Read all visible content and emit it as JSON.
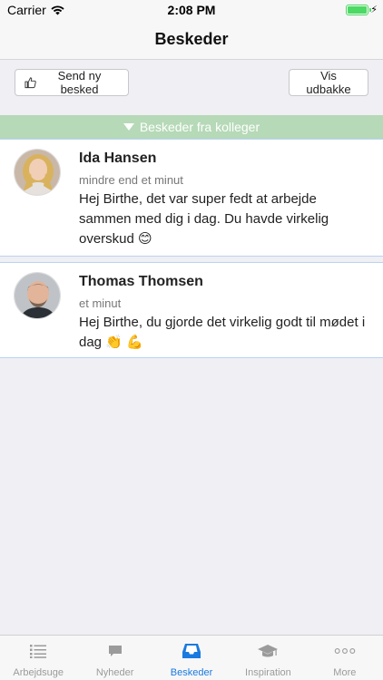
{
  "status": {
    "carrier": "Carrier",
    "time": "2:08 PM"
  },
  "nav": {
    "title": "Beskeder"
  },
  "actions": {
    "send_label": "Send ny besked",
    "outbox_label": "Vis udbakke"
  },
  "section": {
    "title": "Beskeder fra kolleger"
  },
  "messages": [
    {
      "name": "Ida Hansen",
      "time": "mindre end et minut",
      "text": "Hej Birthe, det var super fedt at arbejde sammen med dig i dag. Du havde virkelig overskud 😊"
    },
    {
      "name": "Thomas Thomsen",
      "time": "et minut",
      "text": "Hej Birthe, du gjorde det virkelig godt til mødet i dag 👏 💪"
    }
  ],
  "tabs": [
    {
      "label": "Arbejdsuge",
      "icon": "list-icon"
    },
    {
      "label": "Nyheder",
      "icon": "chat-bubble-icon"
    },
    {
      "label": "Beskeder",
      "icon": "inbox-icon",
      "active": true
    },
    {
      "label": "Inspiration",
      "icon": "graduation-cap-icon"
    },
    {
      "label": "More",
      "icon": "more-dots-icon"
    }
  ],
  "colors": {
    "accent": "#1a7adf",
    "section_header": "#b6d9b7",
    "battery": "#4cd964"
  }
}
